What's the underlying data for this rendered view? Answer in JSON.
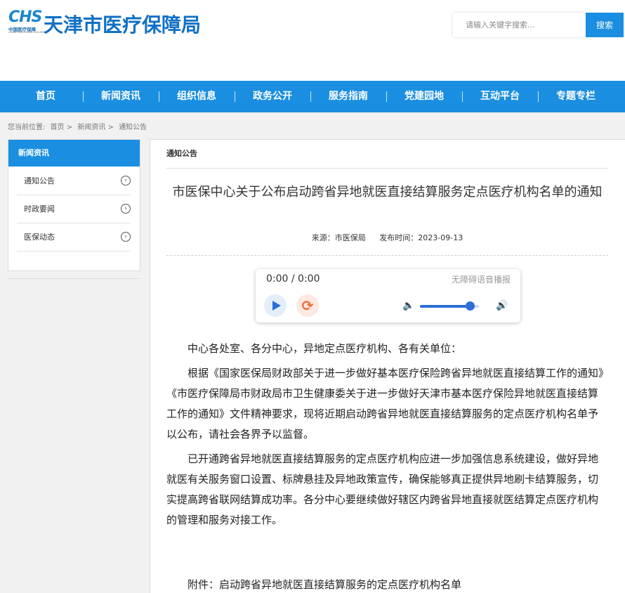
{
  "header": {
    "logo_mark": "CHS",
    "logo_cn": "中国医疗保障",
    "logo_en": "CHINA HEALTHCARE SECURITY",
    "site_title": "天津市医疗保障局",
    "search_placeholder": "请输入关键字搜索...",
    "search_button": "搜索"
  },
  "nav": {
    "items": [
      "首页",
      "新闻资讯",
      "组织信息",
      "政务公开",
      "服务指南",
      "党建园地",
      "互动平台",
      "专题专栏"
    ]
  },
  "breadcrumb": {
    "prefix": "您当前位置:",
    "items": [
      "首页 >",
      "新闻资讯 >",
      "通知公告"
    ]
  },
  "sidebar": {
    "title": "新闻资讯",
    "items": [
      "通知公告",
      "时政要闻",
      "医保动态"
    ]
  },
  "article": {
    "section": "通知公告",
    "title": "市医保中心关于公布启动跨省异地就医直接结算服务定点医疗机构名单的通知",
    "source": "来源：市医保局",
    "date": "发布时间：2023-09-13",
    "paragraphs": [
      "中心各处室、各分中心，异地定点医疗机构、各有关单位：",
      "根据《国家医保局财政部关于进一步做好基本医疗保险跨省异地就医直接结算工作的通知》《市医疗保障局市财政局市卫生健康委关于进一步做好天津市基本医疗保险异地就医直接结算工作的通知》文件精神要求，现将近期启动跨省异地就医直接结算服务的定点医疗机构名单予以公布，请社会各界予以监督。",
      "已开通跨省异地就医直接结算服务的定点医疗机构应进一步加强信息系统建设，做好异地就医有关服务窗口设置、标牌悬挂及异地政策宣传，确保能够真正提供异地刷卡结算服务，切实提高跨省联网结算成功率。各分中心要继续做好辖区内跨省异地直接就医结算定点医疗机构的管理和服务对接工作。"
    ],
    "attachment": "附件：启动跨省异地就医直接结算服务的定点医疗机构名单"
  },
  "player": {
    "time": "0:00 / 0:00",
    "label": "无障碍语音播报",
    "volume": 0.85
  },
  "colors": {
    "brand_blue": "#1a8ee0",
    "title_blue": "#1170c4",
    "player_blue": "#2c6fd6",
    "loop_orange": "#f06a3a"
  }
}
